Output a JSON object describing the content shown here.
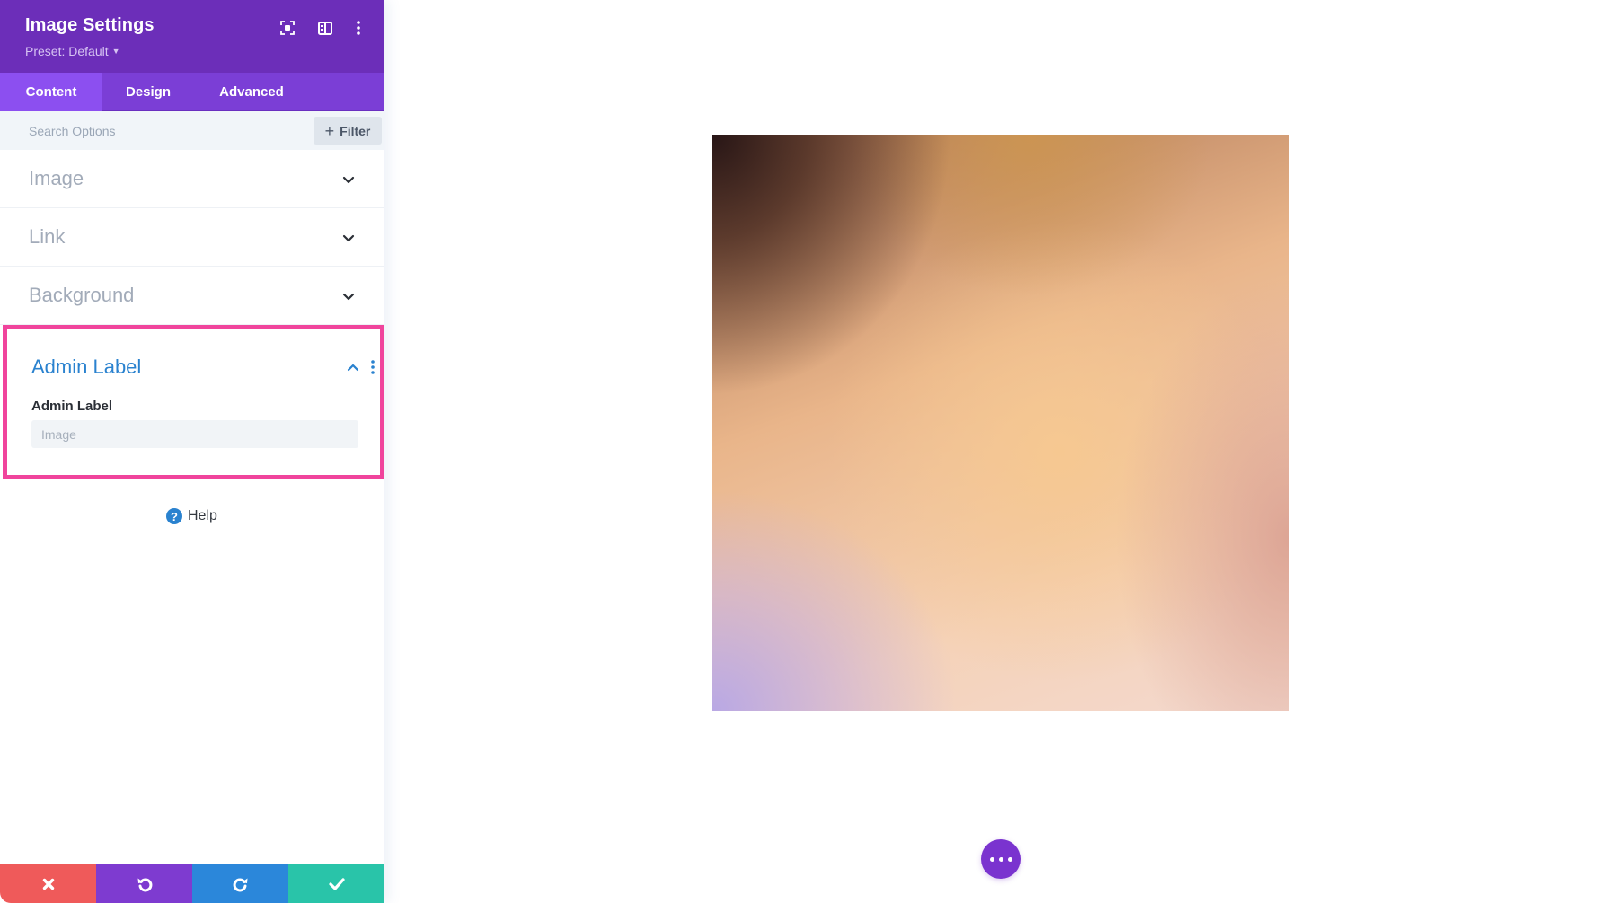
{
  "panel": {
    "title": "Image Settings",
    "preset_label": "Preset: Default",
    "header_icons": [
      "focus-mode-icon",
      "split-view-icon",
      "more-options-icon"
    ],
    "tabs": [
      {
        "label": "Content",
        "active": true
      },
      {
        "label": "Design",
        "active": false
      },
      {
        "label": "Advanced",
        "active": false
      }
    ],
    "search": {
      "placeholder": "Search Options",
      "value": ""
    },
    "filter_label": "Filter",
    "accordions": [
      {
        "label": "Image",
        "expanded": false
      },
      {
        "label": "Link",
        "expanded": false
      },
      {
        "label": "Background",
        "expanded": false
      }
    ],
    "admin_section": {
      "title": "Admin Label",
      "expanded": true,
      "highlight_color": "#f0449c",
      "field_label": "Admin Label",
      "field_placeholder": "Image",
      "field_value": ""
    },
    "help_label": "Help",
    "bottom_actions": [
      {
        "name": "cancel",
        "icon": "close-icon",
        "color": "#ef5a5a"
      },
      {
        "name": "undo",
        "icon": "undo-icon",
        "color": "#7e3bd0"
      },
      {
        "name": "redo",
        "icon": "redo-icon",
        "color": "#2b87da"
      },
      {
        "name": "save",
        "icon": "check-icon",
        "color": "#29c4a9"
      }
    ]
  },
  "colors": {
    "header_purple": "#6c2eb9",
    "tab_purple": "#7b3ed6",
    "active_tab": "#8c4ff0",
    "accent_blue": "#2a82cf",
    "fab_purple": "#7a33cf"
  },
  "canvas": {
    "image_alt": "Blurred warm gradient image",
    "fab_icon": "more-dots-icon"
  }
}
